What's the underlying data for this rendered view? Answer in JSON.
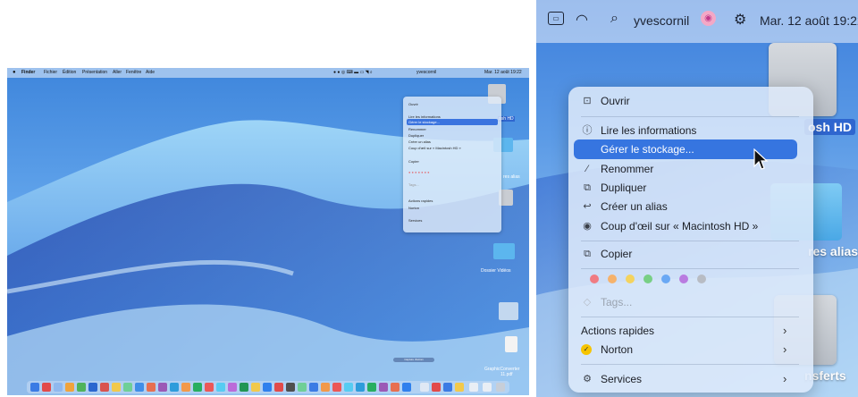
{
  "menubar": {
    "apple": "",
    "app": "Finder",
    "items": [
      "Fichier",
      "Édition",
      "Présentation",
      "Aller",
      "Fenêtre",
      "Aide"
    ],
    "user": "yvescornil",
    "datetime": "Mar. 12 août 19:22",
    "small_datetime": "Mar. 12 août 19:22"
  },
  "context_menu": {
    "open": "Ouvrir",
    "get_info": "Lire les informations",
    "manage_storage": "Gérer le stockage...",
    "rename": "Renommer",
    "duplicate": "Dupliquer",
    "make_alias": "Créer un alias",
    "quick_look": "Coup d'œil sur « Macintosh HD »",
    "copy": "Copier",
    "tags": "Tags...",
    "quick_actions": "Actions rapides",
    "norton": "Norton",
    "services": "Services"
  },
  "tag_colors": [
    "#f07b82",
    "#f6b26b",
    "#f4d35e",
    "#78cf85",
    "#6aa8f4",
    "#b97be0",
    "#b8bcc4"
  ],
  "desktop": {
    "disk_label": "osh HD",
    "alias_label": "res alias",
    "transfers_label": "nsferts",
    "small_disk_label": "osh HD",
    "small_alias_label": "res alias",
    "small_folder_label": "Dossier Vidéos",
    "small_file_label": "GraphicConverter",
    "small_file_sub": "11.pdf",
    "small_pill": "Capture d'écran"
  },
  "colors": {
    "accent": "#3675e0",
    "menubar": "#ecf3fc"
  }
}
